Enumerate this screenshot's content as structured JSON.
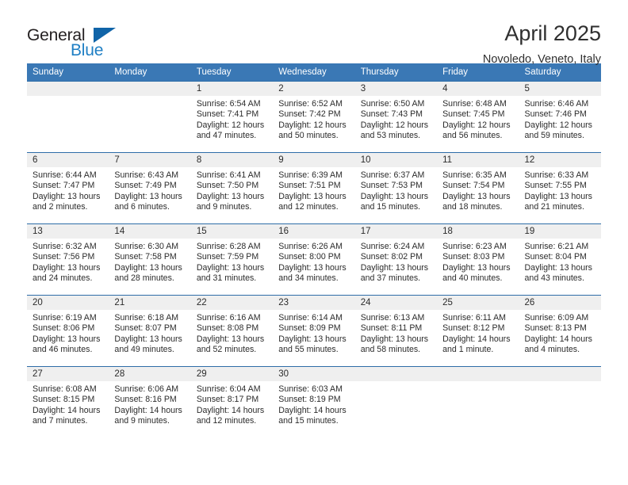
{
  "brand": {
    "name_part1": "General",
    "name_part2": "Blue",
    "accent_color": "#1064a8",
    "blue_text_color": "#1f7fc4"
  },
  "header": {
    "title": "April 2025",
    "subtitle": "Novoledo, Veneto, Italy"
  },
  "theme": {
    "header_bg": "#3a78b5",
    "row_rule": "#2e6da8",
    "daynum_bg": "#efefef"
  },
  "columns": [
    "Sunday",
    "Monday",
    "Tuesday",
    "Wednesday",
    "Thursday",
    "Friday",
    "Saturday"
  ],
  "weeks": [
    [
      {
        "day": "",
        "lines": []
      },
      {
        "day": "",
        "lines": []
      },
      {
        "day": "1",
        "lines": [
          "Sunrise: 6:54 AM",
          "Sunset: 7:41 PM",
          "Daylight: 12 hours",
          "and 47 minutes."
        ]
      },
      {
        "day": "2",
        "lines": [
          "Sunrise: 6:52 AM",
          "Sunset: 7:42 PM",
          "Daylight: 12 hours",
          "and 50 minutes."
        ]
      },
      {
        "day": "3",
        "lines": [
          "Sunrise: 6:50 AM",
          "Sunset: 7:43 PM",
          "Daylight: 12 hours",
          "and 53 minutes."
        ]
      },
      {
        "day": "4",
        "lines": [
          "Sunrise: 6:48 AM",
          "Sunset: 7:45 PM",
          "Daylight: 12 hours",
          "and 56 minutes."
        ]
      },
      {
        "day": "5",
        "lines": [
          "Sunrise: 6:46 AM",
          "Sunset: 7:46 PM",
          "Daylight: 12 hours",
          "and 59 minutes."
        ]
      }
    ],
    [
      {
        "day": "6",
        "lines": [
          "Sunrise: 6:44 AM",
          "Sunset: 7:47 PM",
          "Daylight: 13 hours",
          "and 2 minutes."
        ]
      },
      {
        "day": "7",
        "lines": [
          "Sunrise: 6:43 AM",
          "Sunset: 7:49 PM",
          "Daylight: 13 hours",
          "and 6 minutes."
        ]
      },
      {
        "day": "8",
        "lines": [
          "Sunrise: 6:41 AM",
          "Sunset: 7:50 PM",
          "Daylight: 13 hours",
          "and 9 minutes."
        ]
      },
      {
        "day": "9",
        "lines": [
          "Sunrise: 6:39 AM",
          "Sunset: 7:51 PM",
          "Daylight: 13 hours",
          "and 12 minutes."
        ]
      },
      {
        "day": "10",
        "lines": [
          "Sunrise: 6:37 AM",
          "Sunset: 7:53 PM",
          "Daylight: 13 hours",
          "and 15 minutes."
        ]
      },
      {
        "day": "11",
        "lines": [
          "Sunrise: 6:35 AM",
          "Sunset: 7:54 PM",
          "Daylight: 13 hours",
          "and 18 minutes."
        ]
      },
      {
        "day": "12",
        "lines": [
          "Sunrise: 6:33 AM",
          "Sunset: 7:55 PM",
          "Daylight: 13 hours",
          "and 21 minutes."
        ]
      }
    ],
    [
      {
        "day": "13",
        "lines": [
          "Sunrise: 6:32 AM",
          "Sunset: 7:56 PM",
          "Daylight: 13 hours",
          "and 24 minutes."
        ]
      },
      {
        "day": "14",
        "lines": [
          "Sunrise: 6:30 AM",
          "Sunset: 7:58 PM",
          "Daylight: 13 hours",
          "and 28 minutes."
        ]
      },
      {
        "day": "15",
        "lines": [
          "Sunrise: 6:28 AM",
          "Sunset: 7:59 PM",
          "Daylight: 13 hours",
          "and 31 minutes."
        ]
      },
      {
        "day": "16",
        "lines": [
          "Sunrise: 6:26 AM",
          "Sunset: 8:00 PM",
          "Daylight: 13 hours",
          "and 34 minutes."
        ]
      },
      {
        "day": "17",
        "lines": [
          "Sunrise: 6:24 AM",
          "Sunset: 8:02 PM",
          "Daylight: 13 hours",
          "and 37 minutes."
        ]
      },
      {
        "day": "18",
        "lines": [
          "Sunrise: 6:23 AM",
          "Sunset: 8:03 PM",
          "Daylight: 13 hours",
          "and 40 minutes."
        ]
      },
      {
        "day": "19",
        "lines": [
          "Sunrise: 6:21 AM",
          "Sunset: 8:04 PM",
          "Daylight: 13 hours",
          "and 43 minutes."
        ]
      }
    ],
    [
      {
        "day": "20",
        "lines": [
          "Sunrise: 6:19 AM",
          "Sunset: 8:06 PM",
          "Daylight: 13 hours",
          "and 46 minutes."
        ]
      },
      {
        "day": "21",
        "lines": [
          "Sunrise: 6:18 AM",
          "Sunset: 8:07 PM",
          "Daylight: 13 hours",
          "and 49 minutes."
        ]
      },
      {
        "day": "22",
        "lines": [
          "Sunrise: 6:16 AM",
          "Sunset: 8:08 PM",
          "Daylight: 13 hours",
          "and 52 minutes."
        ]
      },
      {
        "day": "23",
        "lines": [
          "Sunrise: 6:14 AM",
          "Sunset: 8:09 PM",
          "Daylight: 13 hours",
          "and 55 minutes."
        ]
      },
      {
        "day": "24",
        "lines": [
          "Sunrise: 6:13 AM",
          "Sunset: 8:11 PM",
          "Daylight: 13 hours",
          "and 58 minutes."
        ]
      },
      {
        "day": "25",
        "lines": [
          "Sunrise: 6:11 AM",
          "Sunset: 8:12 PM",
          "Daylight: 14 hours",
          "and 1 minute."
        ]
      },
      {
        "day": "26",
        "lines": [
          "Sunrise: 6:09 AM",
          "Sunset: 8:13 PM",
          "Daylight: 14 hours",
          "and 4 minutes."
        ]
      }
    ],
    [
      {
        "day": "27",
        "lines": [
          "Sunrise: 6:08 AM",
          "Sunset: 8:15 PM",
          "Daylight: 14 hours",
          "and 7 minutes."
        ]
      },
      {
        "day": "28",
        "lines": [
          "Sunrise: 6:06 AM",
          "Sunset: 8:16 PM",
          "Daylight: 14 hours",
          "and 9 minutes."
        ]
      },
      {
        "day": "29",
        "lines": [
          "Sunrise: 6:04 AM",
          "Sunset: 8:17 PM",
          "Daylight: 14 hours",
          "and 12 minutes."
        ]
      },
      {
        "day": "30",
        "lines": [
          "Sunrise: 6:03 AM",
          "Sunset: 8:19 PM",
          "Daylight: 14 hours",
          "and 15 minutes."
        ]
      },
      {
        "day": "",
        "lines": []
      },
      {
        "day": "",
        "lines": []
      },
      {
        "day": "",
        "lines": []
      }
    ]
  ]
}
